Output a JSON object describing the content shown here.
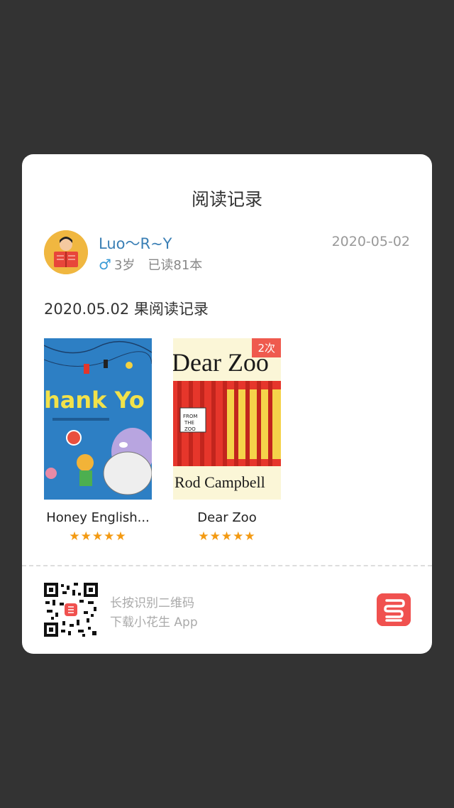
{
  "card": {
    "title": "阅读记录",
    "user": {
      "name": "Luo～R~Y",
      "gender_symbol": "♂",
      "age": "3岁",
      "read_count": "已读81本"
    },
    "date": "2020-05-02",
    "record_title": "2020.05.02 果阅读记录",
    "books": [
      {
        "title": "Honey English...",
        "cover_text": "hank Yo",
        "stars": "★★★★★",
        "rating": 5
      },
      {
        "title": "Dear Zoo",
        "cover_top": "Dear Zoo",
        "cover_bottom": "Rod Campbell",
        "cover_sign": "FROM THE ZOO",
        "stars": "★★★★★",
        "rating": 5,
        "badge": "2次"
      }
    ],
    "footer": {
      "line1": "长按识别二维码",
      "line2": "下载小花生 App",
      "qr_icon": "qr-code-icon",
      "app_icon": "xiaohuasheng-logo-icon"
    }
  },
  "colors": {
    "overlay": "#333333",
    "accent": "#ef5a4e",
    "star": "#f39a12",
    "name": "#3a7fb5"
  }
}
